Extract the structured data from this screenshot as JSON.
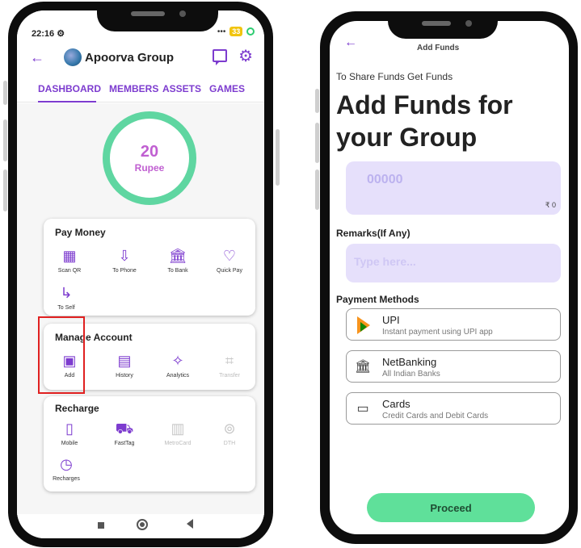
{
  "left_screen": {
    "status": {
      "time": "22:16",
      "settings_glyph": "⚙",
      "signal": "•••",
      "battery": "33"
    },
    "header": {
      "back_icon": "arrow-left-icon",
      "group_name": "Apoorva Group"
    },
    "tabs": [
      "DASHBOARD",
      "MEMBERS",
      "ASSETS",
      "GAMES"
    ],
    "active_tab": "DASHBOARD",
    "balance": {
      "amount": "20",
      "unit": "Rupee"
    },
    "pay_money": {
      "title": "Pay Money",
      "actions": [
        {
          "label": "Scan QR",
          "icon": "qr-icon"
        },
        {
          "label": "To Phone",
          "icon": "phone-transfer-icon"
        },
        {
          "label": "To Bank",
          "icon": "bank-icon"
        },
        {
          "label": "Quick Pay",
          "icon": "heart-icon"
        },
        {
          "label": "To Self",
          "icon": "self-transfer-icon"
        }
      ]
    },
    "manage_account": {
      "title": "Manage Account",
      "actions": [
        {
          "label": "Add",
          "icon": "wallet-icon"
        },
        {
          "label": "History",
          "icon": "receipt-icon"
        },
        {
          "label": "Analytics",
          "icon": "sparkle-icon"
        },
        {
          "label": "Transfer",
          "icon": "crop-icon",
          "disabled": true
        }
      ]
    },
    "recharge": {
      "title": "Recharge",
      "actions": [
        {
          "label": "Mobile",
          "icon": "mobile-icon"
        },
        {
          "label": "FastTag",
          "icon": "car-icon"
        },
        {
          "label": "MetroCard",
          "icon": "train-icon",
          "disabled": true
        },
        {
          "label": "DTH",
          "icon": "antenna-icon",
          "disabled": true
        },
        {
          "label": "Recharges",
          "icon": "recharge-history-icon"
        }
      ]
    }
  },
  "right_screen": {
    "header_title": "Add Funds",
    "subtitle": "To Share Funds Get Funds",
    "title": "Add Funds for your Group",
    "amount": {
      "placeholder": "00000",
      "value": "",
      "currency_hint": "₹ 0"
    },
    "remarks": {
      "label": "Remarks(If Any)",
      "placeholder": "Type here..."
    },
    "payment_methods": {
      "label": "Payment Methods",
      "options": [
        {
          "name": "UPI",
          "desc": "Instant payment using UPI app",
          "icon": "upi-icon"
        },
        {
          "name": "NetBanking",
          "desc": "All Indian Banks",
          "icon": "bank-icon"
        },
        {
          "name": "Cards",
          "desc": "Credit Cards and Debit Cards",
          "icon": "card-icon"
        }
      ]
    },
    "proceed_label": "Proceed"
  },
  "colors": {
    "accent": "#7d3ccf",
    "ring": "#5fd6a1",
    "balance_text": "#c05fd1",
    "input_bg": "#e6e0fb",
    "proceed_bg": "#5fe09a",
    "highlight": "#e02020"
  }
}
